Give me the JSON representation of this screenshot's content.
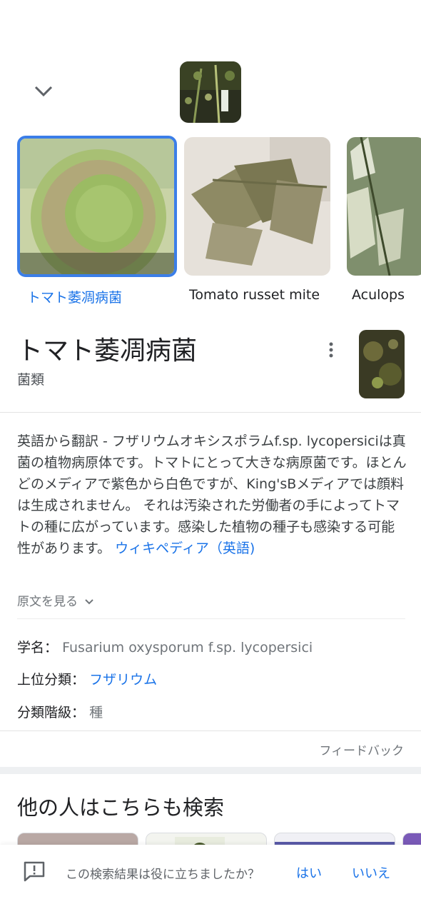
{
  "carousel": {
    "cards": [
      {
        "label": "トマト萎凋病菌",
        "selected": true
      },
      {
        "label": "Tomato russet mite",
        "selected": false
      },
      {
        "label": "Aculops",
        "selected": false
      }
    ]
  },
  "entity": {
    "title": "トマト萎凋病菌",
    "subtitle": "菌類",
    "description": "英語から翻訳 - フザリウムオキシスポラムf.sp. lycopersiciは真菌の植物病原体です。トマトにとって大きな病原菌です。ほとんどのメディアで紫色から白色ですが、King'sBメディアでは顔料は生成されません。 それは汚染された労働者の手によってトマトの種に広がっています。感染した植物の種子も感染する可能性があります。",
    "wiki_link": "ウィキペディア（英語)",
    "show_original": "原文を見る"
  },
  "facts": {
    "scientific_name_label": "学名：",
    "scientific_name_value": "Fusarium oxysporum f.sp. lycopersici",
    "parent_label": "上位分類：",
    "parent_value": "フザリウム",
    "rank_label": "分類階級：",
    "rank_value": "種"
  },
  "feedback": "フィードバック",
  "people_also_search": "他の人はこちらも検索",
  "bottom_bar": {
    "question": "この検索結果は役に立ちましたか？",
    "yes": "はい",
    "no": "いいえ"
  },
  "colors": {
    "accent": "#1a73e8",
    "selected_border": "#3b7ee8"
  }
}
